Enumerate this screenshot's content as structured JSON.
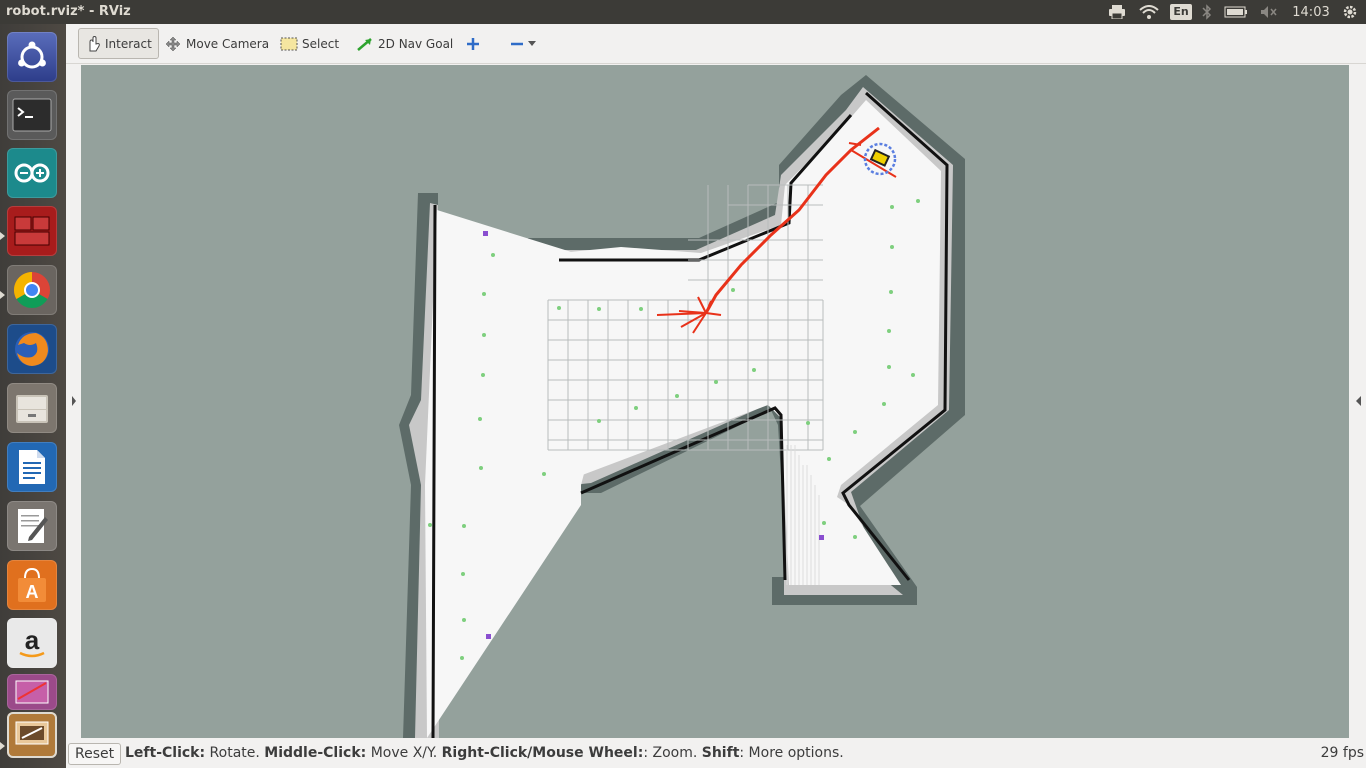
{
  "topbar": {
    "title": "robot.rviz* - RViz",
    "language": "En",
    "clock": "14:03"
  },
  "launcher": {
    "items": [
      {
        "name": "ubuntu-dash-icon"
      },
      {
        "name": "terminal-icon"
      },
      {
        "name": "arduino-icon"
      },
      {
        "name": "terminator-icon"
      },
      {
        "name": "chrome-icon"
      },
      {
        "name": "firefox-icon"
      },
      {
        "name": "files-icon"
      },
      {
        "name": "writer-icon"
      },
      {
        "name": "text-editor-icon"
      },
      {
        "name": "software-center-icon"
      },
      {
        "name": "amazon-icon"
      },
      {
        "name": "rviz-icon"
      }
    ]
  },
  "toolbar": {
    "interact_label": "Interact",
    "move_camera_label": "Move Camera",
    "select_label": "Select",
    "nav_goal_label": "2D Nav Goal"
  },
  "status": {
    "reset_label": "Reset",
    "hint_left_click": "Left-Click:",
    "hint_rotate": " Rotate. ",
    "hint_middle_click": "Middle-Click:",
    "hint_move": " Move X/Y. ",
    "hint_right_click": "Right-Click/Mouse Wheel:",
    "hint_zoom": ": Zoom. ",
    "hint_shift": "Shift",
    "hint_more": ": More options.",
    "fps": "29 fps"
  },
  "colors": {
    "map_unknown": "#94a19c",
    "map_free": "#f7f7f7",
    "inflation": "#c8c8c8",
    "obstacle_halo": "#5d6b68",
    "wall": "#111111",
    "path": "#e8321a",
    "particles": "#7ecf7e",
    "panel": "#3c3b37"
  }
}
